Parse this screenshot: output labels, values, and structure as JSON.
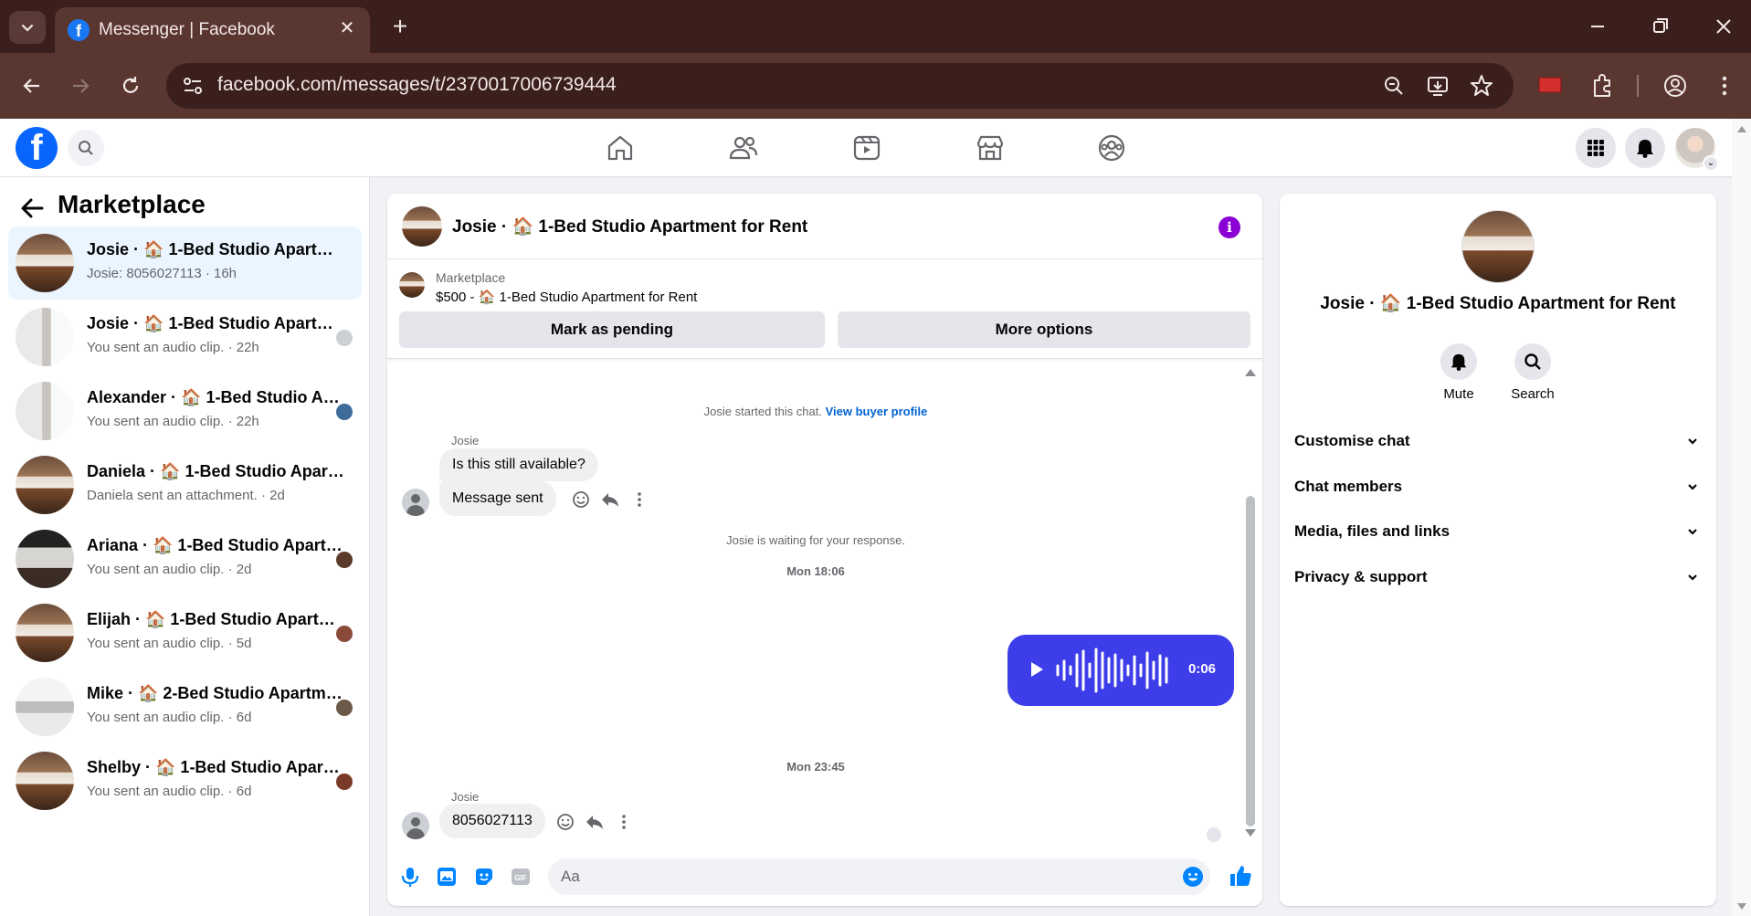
{
  "browser": {
    "tab_title": "Messenger | Facebook",
    "url": "facebook.com/messages/t/2370017006739444"
  },
  "sidebar": {
    "title": "Marketplace",
    "conversations": [
      {
        "name": "Josie · 🏠 1-Bed Studio Apartment for Rent",
        "preview": "Josie: 8056027113 · 16h",
        "active": true
      },
      {
        "name": "Josie · 🏠 1-Bed Studio Apartment for Rent",
        "preview": "You sent an audio clip. · 22h"
      },
      {
        "name": "Alexander · 🏠 1-Bed Studio Apartment for Rent",
        "preview": "You sent an audio clip. · 22h"
      },
      {
        "name": "Daniela · 🏠 1-Bed Studio Apartment for Rent",
        "preview": "Daniela sent an attachment. · 2d"
      },
      {
        "name": "Ariana · 🏠 1-Bed Studio Apartment for Rent",
        "preview": "You sent an audio clip. · 2d"
      },
      {
        "name": "Elijah · 🏠 1-Bed Studio Apartment for Rent",
        "preview": "You sent an audio clip. · 5d"
      },
      {
        "name": "Mike · 🏠 2-Bed Studio Apartment for Rent",
        "preview": "You sent an audio clip. · 6d"
      },
      {
        "name": "Shelby · 🏠 1-Bed Studio Apartment for Rent",
        "preview": "You sent an audio clip. · 6d"
      }
    ]
  },
  "chat": {
    "title": "Josie · 🏠 1-Bed Studio Apartment for Rent",
    "listing": {
      "label": "Marketplace",
      "price_line": "$500 - 🏠 1-Bed Studio Apartment for Rent",
      "mark_pending": "Mark as pending",
      "more_options": "More options"
    },
    "started_text": "Josie started this chat.",
    "view_profile": "View buyer profile",
    "sender_1": "Josie",
    "msg_1": "Is this still available?",
    "msg_2": "Message sent",
    "waiting_text": "Josie is waiting for your response.",
    "time_1": "Mon 18:06",
    "audio_duration": "0:06",
    "time_2": "Mon 23:45",
    "sender_2": "Josie",
    "msg_3": "8056027113",
    "composer_placeholder": "Aa"
  },
  "details": {
    "title": "Josie · 🏠 1-Bed Studio Apartment for Rent",
    "mute": "Mute",
    "search": "Search",
    "sections": [
      "Customise chat",
      "Chat members",
      "Media, files and links",
      "Privacy & support"
    ]
  },
  "colors": {
    "facebook_blue": "#0866ff",
    "messenger_blue": "#0084ff",
    "audio_bubble": "#3d3dea",
    "active_row": "#ebf5ff",
    "browser_frame": "#5a3631"
  }
}
